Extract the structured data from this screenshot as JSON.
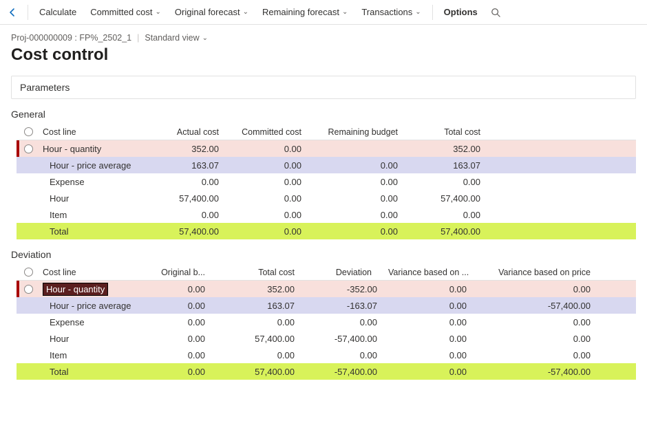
{
  "toolbar": {
    "calculate": "Calculate",
    "committed_cost": "Committed cost",
    "original_forecast": "Original forecast",
    "remaining_forecast": "Remaining forecast",
    "transactions": "Transactions",
    "options": "Options"
  },
  "breadcrumb": {
    "project": "Proj-000000009 : FP%_2502_1",
    "standard_view": "Standard view"
  },
  "page_title": "Cost control",
  "parameters_title": "Parameters",
  "general": {
    "title": "General",
    "headers": {
      "cost_line": "Cost line",
      "actual_cost": "Actual cost",
      "committed_cost": "Committed cost",
      "remaining_budget": "Remaining budget",
      "total_cost": "Total cost"
    },
    "rows": [
      {
        "label": "Hour - quantity",
        "actual": "352.00",
        "committed": "0.00",
        "remaining": "",
        "total": "352.00",
        "style": "pink",
        "radio": true,
        "indent": false,
        "selected": true
      },
      {
        "label": "Hour - price average",
        "actual": "163.07",
        "committed": "0.00",
        "remaining": "0.00",
        "total": "163.07",
        "style": "lav",
        "radio": false,
        "indent": true,
        "selected": false
      },
      {
        "label": "Expense",
        "actual": "0.00",
        "committed": "0.00",
        "remaining": "0.00",
        "total": "0.00",
        "style": "",
        "radio": false,
        "indent": true,
        "selected": false
      },
      {
        "label": "Hour",
        "actual": "57,400.00",
        "committed": "0.00",
        "remaining": "0.00",
        "total": "57,400.00",
        "style": "",
        "radio": false,
        "indent": true,
        "selected": false
      },
      {
        "label": "Item",
        "actual": "0.00",
        "committed": "0.00",
        "remaining": "0.00",
        "total": "0.00",
        "style": "",
        "radio": false,
        "indent": true,
        "selected": false
      },
      {
        "label": "Total",
        "actual": "57,400.00",
        "committed": "0.00",
        "remaining": "0.00",
        "total": "57,400.00",
        "style": "lime",
        "radio": false,
        "indent": true,
        "selected": false
      }
    ]
  },
  "deviation": {
    "title": "Deviation",
    "headers": {
      "cost_line": "Cost line",
      "original_b": "Original b...",
      "total_cost": "Total cost",
      "deviation": "Deviation",
      "var_q": "Variance based on ...",
      "var_p": "Variance based on price"
    },
    "rows": [
      {
        "label": "Hour - quantity",
        "orig": "0.00",
        "total": "352.00",
        "dev": "-352.00",
        "varq": "0.00",
        "varp": "0.00",
        "style": "pink",
        "radio": true,
        "indent": false,
        "selected": true,
        "hl": true
      },
      {
        "label": "Hour - price average",
        "orig": "0.00",
        "total": "163.07",
        "dev": "-163.07",
        "varq": "0.00",
        "varp": "-57,400.00",
        "style": "lav",
        "radio": false,
        "indent": true,
        "selected": false,
        "hl": false
      },
      {
        "label": "Expense",
        "orig": "0.00",
        "total": "0.00",
        "dev": "0.00",
        "varq": "0.00",
        "varp": "0.00",
        "style": "",
        "radio": false,
        "indent": true,
        "selected": false,
        "hl": false
      },
      {
        "label": "Hour",
        "orig": "0.00",
        "total": "57,400.00",
        "dev": "-57,400.00",
        "varq": "0.00",
        "varp": "0.00",
        "style": "",
        "radio": false,
        "indent": true,
        "selected": false,
        "hl": false
      },
      {
        "label": "Item",
        "orig": "0.00",
        "total": "0.00",
        "dev": "0.00",
        "varq": "0.00",
        "varp": "0.00",
        "style": "",
        "radio": false,
        "indent": true,
        "selected": false,
        "hl": false
      },
      {
        "label": "Total",
        "orig": "0.00",
        "total": "57,400.00",
        "dev": "-57,400.00",
        "varq": "0.00",
        "varp": "-57,400.00",
        "style": "lime",
        "radio": false,
        "indent": true,
        "selected": false,
        "hl": false
      }
    ]
  }
}
